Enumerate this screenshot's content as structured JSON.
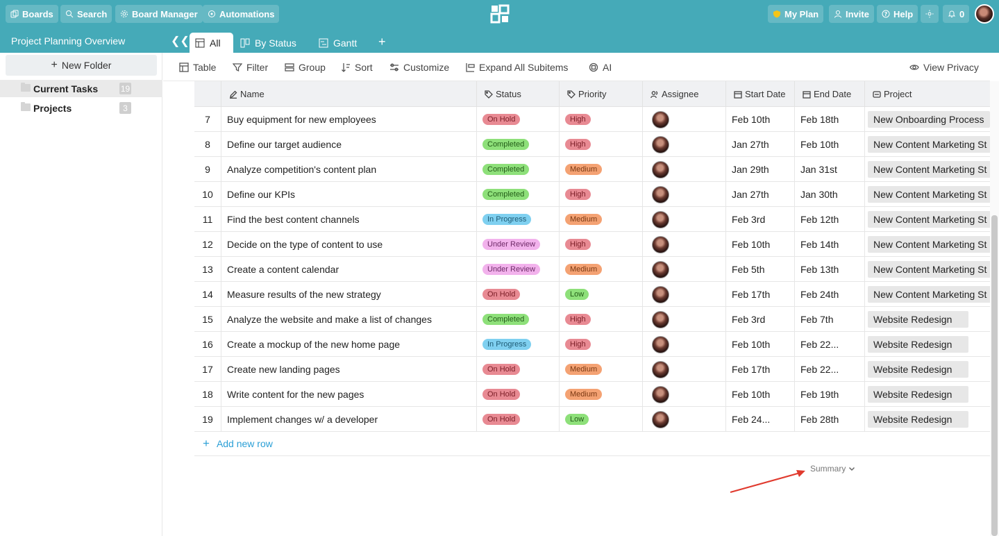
{
  "topbar": {
    "boards": "Boards",
    "search": "Search",
    "board_manager": "Board Manager",
    "automations": "Automations",
    "my_plan": "My Plan",
    "invite": "Invite",
    "help": "Help",
    "notifications": "0",
    "accent": "#45aab8"
  },
  "board": {
    "title": "Project Planning Overview",
    "tabs": [
      "All",
      "By Status",
      "Gantt"
    ]
  },
  "sidebar": {
    "new_folder": "New Folder",
    "folders": [
      {
        "label": "Current Tasks",
        "count": "19"
      },
      {
        "label": "Projects",
        "count": "3"
      }
    ]
  },
  "toolbar": {
    "table": "Table",
    "filter": "Filter",
    "group": "Group",
    "sort": "Sort",
    "customize": "Customize",
    "expand": "Expand All Subitems",
    "ai": "AI",
    "privacy": "View Privacy"
  },
  "columns": {
    "name": "Name",
    "status": "Status",
    "priority": "Priority",
    "assignee": "Assignee",
    "start": "Start Date",
    "end": "End Date",
    "project": "Project"
  },
  "status_colors": {
    "On Hold": {
      "bg": "#e88a93",
      "fg": "#7a1d26"
    },
    "Completed": {
      "bg": "#8ee07a",
      "fg": "#235c18"
    },
    "In Progress": {
      "bg": "#7fd0f0",
      "fg": "#1d5a74"
    },
    "Under Review": {
      "bg": "#f2b2ec",
      "fg": "#6f2a68"
    }
  },
  "priority_colors": {
    "High": {
      "bg": "#e88a93",
      "fg": "#7a1d26"
    },
    "Medium": {
      "bg": "#f4a273",
      "fg": "#7a3812"
    },
    "Low": {
      "bg": "#8ee07a",
      "fg": "#235c18"
    }
  },
  "rows": [
    {
      "num": "7",
      "name": "Buy equipment for new employees",
      "status": "On Hold",
      "priority": "High",
      "start": "Feb 10th",
      "end": "Feb 18th",
      "project": "New Onboarding Process"
    },
    {
      "num": "8",
      "name": "Define our target audience",
      "status": "Completed",
      "priority": "High",
      "start": "Jan 27th",
      "end": "Feb 10th",
      "project": "New Content Marketing St"
    },
    {
      "num": "9",
      "name": "Analyze competition's content plan",
      "status": "Completed",
      "priority": "Medium",
      "start": "Jan 29th",
      "end": "Jan 31st",
      "project": "New Content Marketing St"
    },
    {
      "num": "10",
      "name": "Define our KPIs",
      "status": "Completed",
      "priority": "High",
      "start": "Jan 27th",
      "end": "Jan 30th",
      "project": "New Content Marketing St"
    },
    {
      "num": "11",
      "name": "Find the best content channels",
      "status": "In Progress",
      "priority": "Medium",
      "start": "Feb 3rd",
      "end": "Feb 12th",
      "project": "New Content Marketing St"
    },
    {
      "num": "12",
      "name": "Decide on the type of content to use",
      "status": "Under Review",
      "priority": "High",
      "start": "Feb 10th",
      "end": "Feb 14th",
      "project": "New Content Marketing St"
    },
    {
      "num": "13",
      "name": "Create a content calendar",
      "status": "Under Review",
      "priority": "Medium",
      "start": "Feb 5th",
      "end": "Feb 13th",
      "project": "New Content Marketing St"
    },
    {
      "num": "14",
      "name": "Measure results of the new strategy",
      "status": "On Hold",
      "priority": "Low",
      "start": "Feb 17th",
      "end": "Feb 24th",
      "project": "New Content Marketing St"
    },
    {
      "num": "15",
      "name": "Analyze the website and make a list of changes",
      "status": "Completed",
      "priority": "High",
      "start": "Feb 3rd",
      "end": "Feb 7th",
      "project": "Website Redesign"
    },
    {
      "num": "16",
      "name": "Create a mockup of the new home page",
      "status": "In Progress",
      "priority": "High",
      "start": "Feb 10th",
      "end": "Feb 22...",
      "project": "Website Redesign"
    },
    {
      "num": "17",
      "name": "Create new landing pages",
      "status": "On Hold",
      "priority": "Medium",
      "start": "Feb 17th",
      "end": "Feb 22...",
      "project": "Website Redesign"
    },
    {
      "num": "18",
      "name": "Write content for the new pages",
      "status": "On Hold",
      "priority": "Medium",
      "start": "Feb 10th",
      "end": "Feb 19th",
      "project": "Website Redesign"
    },
    {
      "num": "19",
      "name": "Implement changes w/ a developer",
      "status": "On Hold",
      "priority": "Low",
      "start": "Feb 24...",
      "end": "Feb 28th",
      "project": "Website Redesign"
    }
  ],
  "add_row": "Add new row",
  "summary": "Summary"
}
